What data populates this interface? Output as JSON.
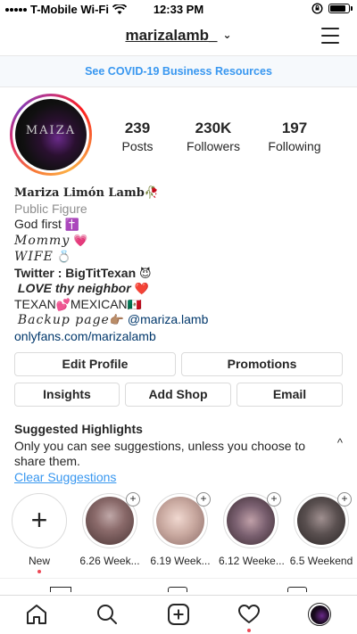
{
  "status_bar": {
    "carrier": "T-Mobile Wi-Fi",
    "time": "12:33 PM"
  },
  "header": {
    "username": "marizalamb_"
  },
  "banner": {
    "text": "See COVID-19 Business Resources"
  },
  "profile": {
    "avatar_text": "MAIZA",
    "stats": [
      {
        "value": "239",
        "label": "Posts"
      },
      {
        "value": "230K",
        "label": "Followers"
      },
      {
        "value": "197",
        "label": "Following"
      }
    ]
  },
  "bio": {
    "name": "Mariza Limón Lamb",
    "name_emoji": "🥀",
    "category": "Public Figure",
    "line1": "God first",
    "line1_emoji": "✝️",
    "line2": "Mommy",
    "line2_emoji": "💗",
    "line3": "WIFE",
    "line3_emoji": "💍",
    "line4": "Twitter : BigTitTexan",
    "line4_emoji": "😈",
    "line5": "LOVE thy neighbor",
    "line5_emoji": "❤️",
    "line6a": "TEXAN",
    "line6_emoji1": "💕",
    "line6b": "MEXICAN",
    "line6_emoji2": "🇲🇽",
    "line7": "Backup page",
    "line7_emoji": "👉🏽",
    "mention": "@mariza.lamb",
    "link": "onlyfans.com/marizalamb"
  },
  "buttons": {
    "edit_profile": "Edit Profile",
    "promotions": "Promotions",
    "insights": "Insights",
    "add_shop": "Add Shop",
    "email": "Email"
  },
  "suggested": {
    "title": "Suggested Highlights",
    "text": "Only you can see suggestions, unless you choose to share them.",
    "clear": "Clear Suggestions",
    "caret": "^"
  },
  "highlights": [
    {
      "label": "New"
    },
    {
      "label": "6.26 Week...",
      "color": "#8a6a6a"
    },
    {
      "label": "6.19 Week...",
      "color": "#c9a9a0"
    },
    {
      "label": "6.12 Weeke...",
      "color": "#7a6070"
    },
    {
      "label": "6.5 Weekend",
      "color": "#5a5050"
    }
  ],
  "colors": {
    "accent_blue": "#3897f0",
    "notification_red": "#ed4956",
    "border": "#dbdbdb"
  },
  "nav": {
    "items": [
      "home-icon",
      "search-icon",
      "add-post-icon",
      "activity-heart-icon",
      "profile-avatar"
    ]
  }
}
